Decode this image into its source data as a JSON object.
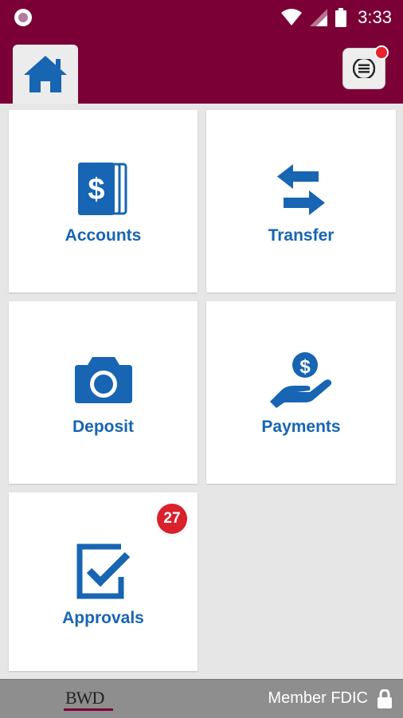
{
  "status_bar": {
    "time": "3:33",
    "icons": [
      "notification-dot-icon",
      "wifi-icon",
      "cell-signal-icon",
      "battery-icon"
    ]
  },
  "app_bar": {
    "home_icon": "home-icon",
    "menu_icon": "hamburger-menu-icon",
    "menu_notification": true
  },
  "tiles": [
    {
      "label": "Accounts",
      "icon": "accounts-dollar-cards-icon"
    },
    {
      "label": "Transfer",
      "icon": "transfer-arrows-icon"
    },
    {
      "label": "Deposit",
      "icon": "camera-icon"
    },
    {
      "label": "Payments",
      "icon": "hand-coin-icon"
    },
    {
      "label": "Approvals",
      "icon": "checkbox-check-icon",
      "badge": "27"
    }
  ],
  "footer": {
    "logo_text": "BWD",
    "fdic_text": "Member FDIC",
    "lock_icon": "lock-icon"
  },
  "colors": {
    "brand": "#7a0036",
    "accent": "#1765b3",
    "badge": "#d9222c",
    "background": "#e6e6e6",
    "footer": "#8e8e8e"
  }
}
